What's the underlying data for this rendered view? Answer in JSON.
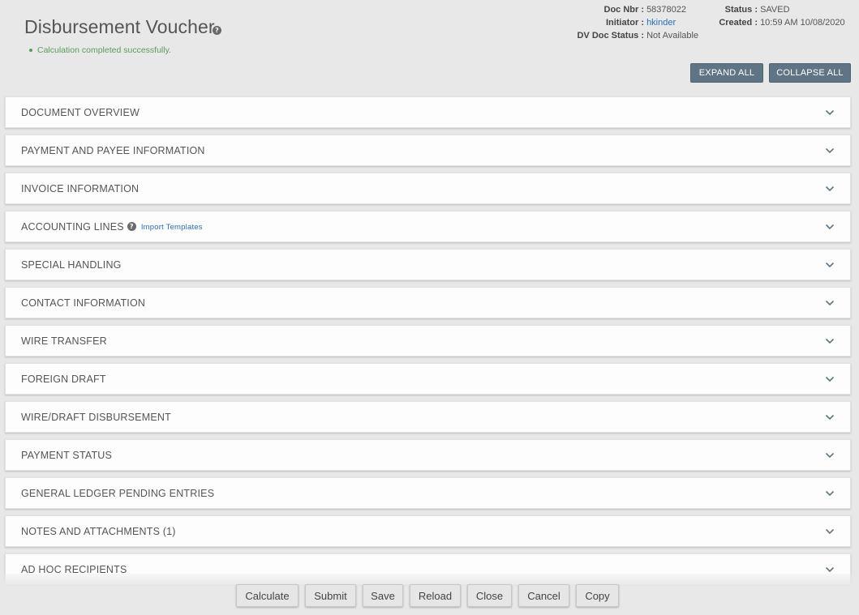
{
  "header": {
    "title": "Disbursement Voucher",
    "message": "Calculation completed successfully.",
    "doc_nbr_label": "Doc Nbr :",
    "doc_nbr": "58378022",
    "initiator_label": "Initiator :",
    "initiator": "hkinder",
    "dv_status_label": "DV Doc Status :",
    "dv_status": "Not Available",
    "status_label": "Status :",
    "status": "SAVED",
    "created_label": "Created :",
    "created": "10:59 AM 10/08/2020"
  },
  "toolbar": {
    "expand_all": "EXPAND ALL",
    "collapse_all": "COLLAPSE ALL"
  },
  "sections": [
    {
      "label": "DOCUMENT OVERVIEW"
    },
    {
      "label": "PAYMENT AND PAYEE INFORMATION"
    },
    {
      "label": "INVOICE INFORMATION"
    },
    {
      "label": "ACCOUNTING LINES",
      "link": "Import Templates"
    },
    {
      "label": "SPECIAL HANDLING"
    },
    {
      "label": "CONTACT INFORMATION"
    },
    {
      "label": "WIRE TRANSFER"
    },
    {
      "label": "FOREIGN DRAFT"
    },
    {
      "label": "WIRE/DRAFT DISBURSEMENT"
    },
    {
      "label": "PAYMENT STATUS"
    },
    {
      "label": "GENERAL LEDGER PENDING ENTRIES"
    },
    {
      "label": "NOTES AND ATTACHMENTS (1)"
    },
    {
      "label": "AD HOC RECIPIENTS"
    }
  ],
  "footer": {
    "calculate": "Calculate",
    "submit": "Submit",
    "save": "Save",
    "reload": "Reload",
    "close": "Close",
    "cancel": "Cancel",
    "copy": "Copy"
  },
  "icons": {
    "help": "help-circle-icon",
    "chevron": "chevron-down-icon"
  },
  "colors": {
    "accent_button": "#5f7585",
    "success_text": "#5a9a5f",
    "link": "#2a6eb5"
  }
}
